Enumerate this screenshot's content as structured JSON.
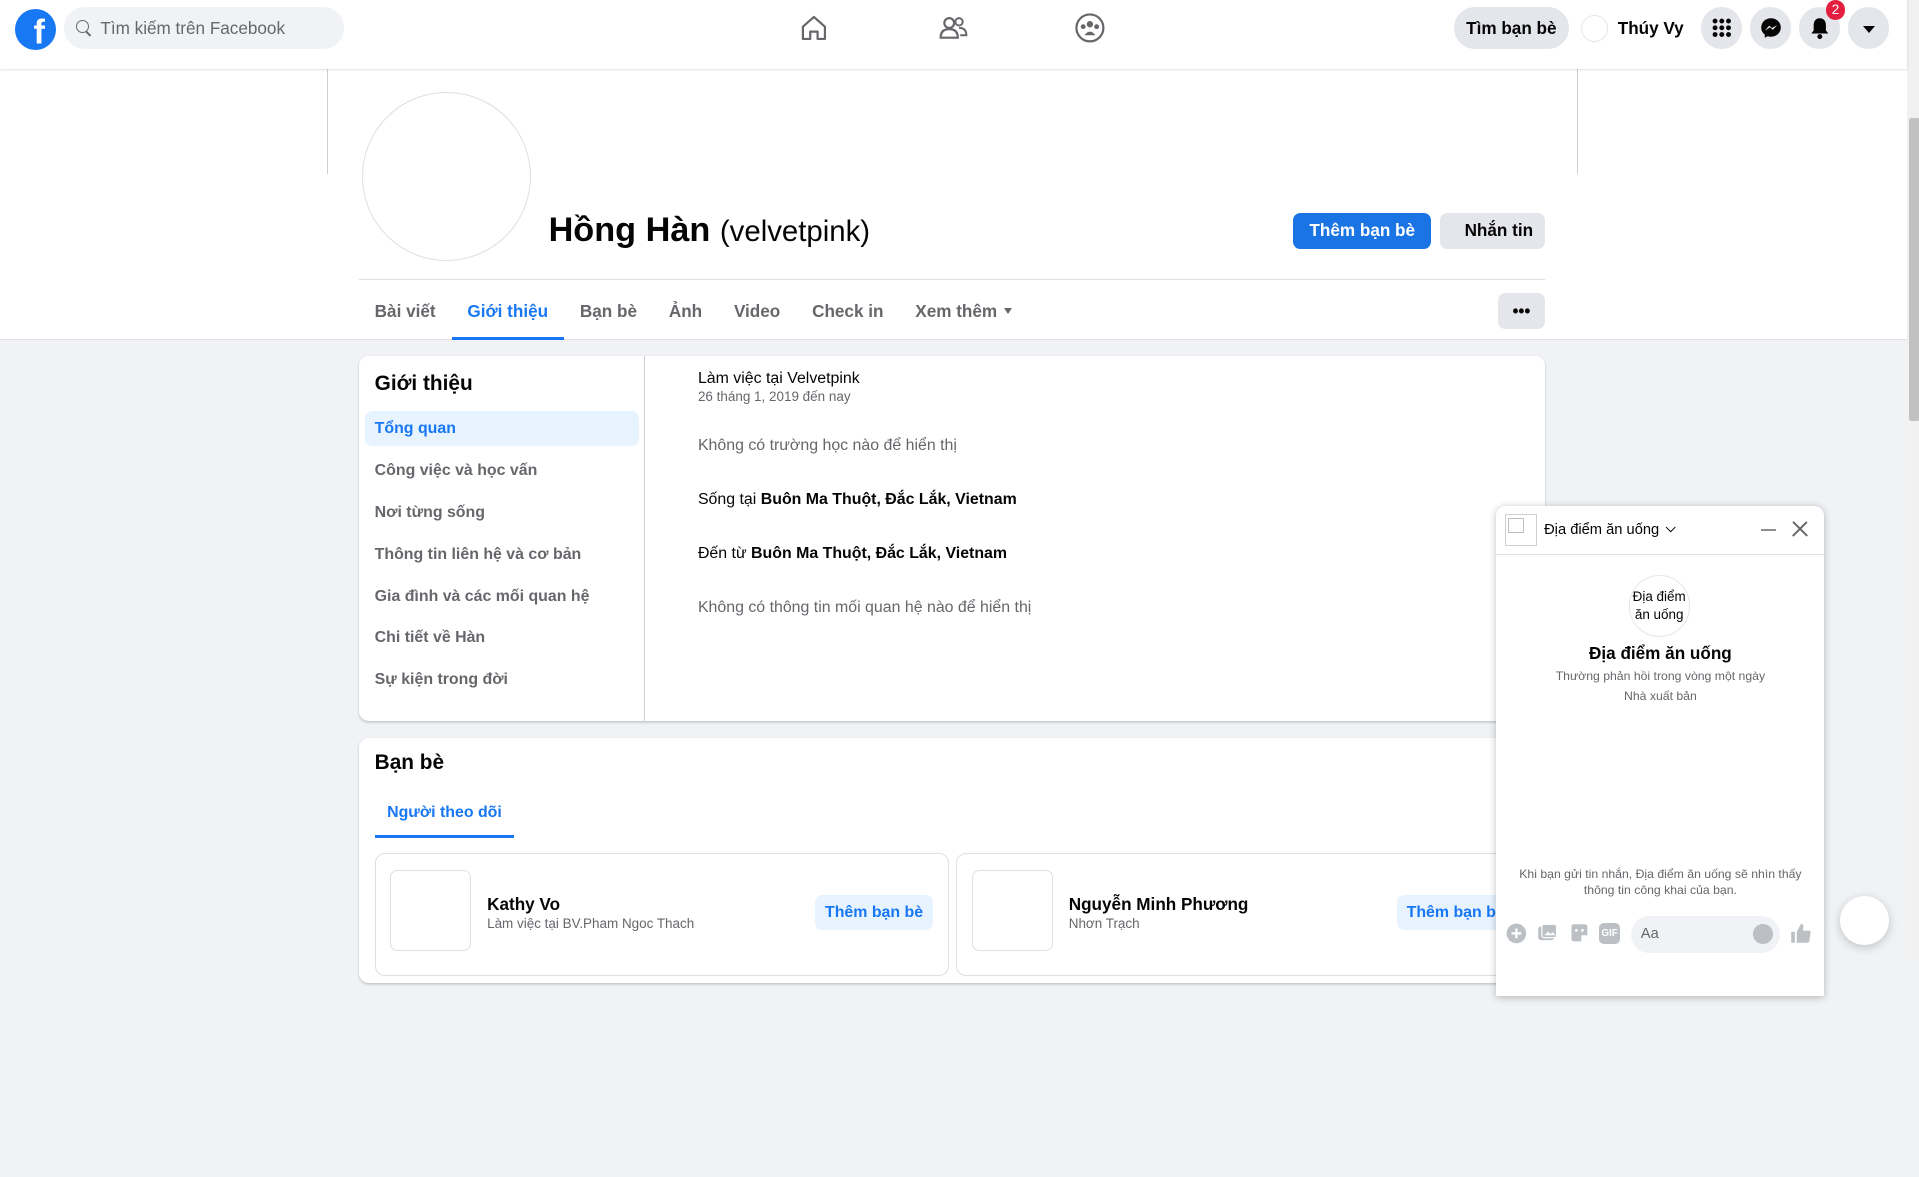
{
  "topbar": {
    "logo": "f",
    "search_placeholder": "Tìm kiếm trên Facebook",
    "find_friends": "Tìm bạn bè",
    "user_name": "Thúy Vy",
    "notification_count": "2",
    "brand_color": "#1877f2"
  },
  "profile": {
    "name": "Hồng Hàn",
    "alt_name": "(velvetpink)",
    "add_friend": "Thêm bạn bè",
    "message": "Nhắn tin"
  },
  "tabs": [
    {
      "label": "Bài viết",
      "active": false
    },
    {
      "label": "Giới thiệu",
      "active": true
    },
    {
      "label": "Bạn bè",
      "active": false
    },
    {
      "label": "Ảnh",
      "active": false
    },
    {
      "label": "Video",
      "active": false
    },
    {
      "label": "Check in",
      "active": false
    },
    {
      "label": "Xem thêm",
      "active": false
    }
  ],
  "more_button": "•••",
  "intro": {
    "title": "Giới thiệu",
    "menu": [
      "Tổng quan",
      "Công việc và học vấn",
      "Nơi từng sống",
      "Thông tin liên hệ và cơ bản",
      "Gia đình và các mối quan hệ",
      "Chi tiết về Hàn",
      "Sự kiện trong đời"
    ],
    "work": "Làm việc tại Velvetpink",
    "work_date": "26 tháng 1, 2019 đến nay",
    "school": "Không có trường học nào để hiển thị",
    "lives_prefix": "Sống tại ",
    "lives_place": "Buôn Ma Thuột, Đắc Lắk, Vietnam",
    "from_prefix": "Đến từ ",
    "from_place": "Buôn Ma Thuột, Đắc Lắk, Vietnam",
    "relationship": "Không có thông tin mối quan hệ nào để hiển thị"
  },
  "friends": {
    "title": "Bạn bè",
    "tab": "Người theo dõi",
    "cards": [
      {
        "name": "Kathy Vo",
        "sub": "Làm việc tại BV.Pham Ngoc Thach",
        "button": "Thêm bạn bè"
      },
      {
        "name": "Nguyễn Minh Phương",
        "sub": "Nhơn Trạch",
        "button": "Thêm bạn bè"
      }
    ]
  },
  "chat": {
    "title": "Địa điểm ăn uống",
    "avatar_alt": "Địa điểm ăn uống",
    "name": "Địa điểm ăn uống",
    "response": "Thường phản hồi trong vòng một ngày",
    "role": "Nhà xuất bản",
    "note": "Khi bạn gửi tin nhắn, Địa điểm ăn uống sẽ nhìn thấy thông tin công khai của bạn.",
    "input_placeholder": "Aa",
    "gif_label": "GIF"
  }
}
